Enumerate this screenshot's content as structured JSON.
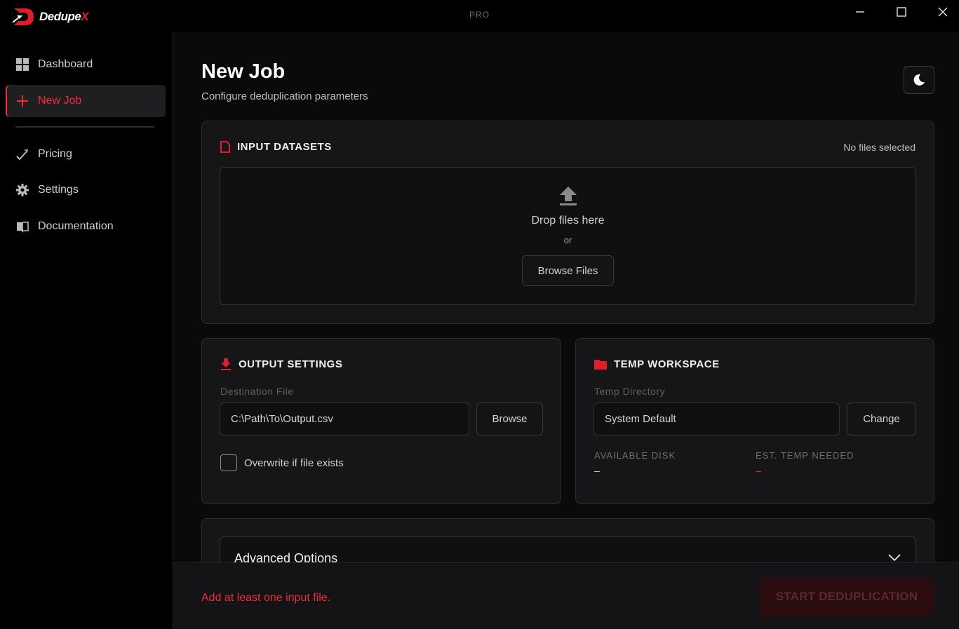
{
  "app": {
    "name_main": "Dedupe",
    "name_accent": "X",
    "edition": "PRO"
  },
  "colors": {
    "accent": "#ef2b36",
    "background": "#0a0a0a",
    "card": "#161618",
    "sidebar": "#000000"
  },
  "sidebar": {
    "items": [
      {
        "label": "Dashboard",
        "icon": "grid-icon",
        "active": false
      },
      {
        "label": "New Job",
        "icon": "plus-icon",
        "active": true
      },
      {
        "label": "Pricing",
        "icon": "trend-check-icon",
        "active": false
      },
      {
        "label": "Settings",
        "icon": "gear-icon",
        "active": false
      },
      {
        "label": "Documentation",
        "icon": "book-icon",
        "active": false
      }
    ]
  },
  "header": {
    "title": "New Job",
    "subtitle": "Configure deduplication parameters",
    "theme_toggle_icon": "moon-icon"
  },
  "input_datasets": {
    "title": "INPUT DATASETS",
    "status": "No files selected",
    "drop_text": "Drop files here",
    "or_text": "or",
    "browse_label": "Browse Files"
  },
  "output_settings": {
    "title": "OUTPUT SETTINGS",
    "field_label": "Destination File",
    "value": "C:\\Path\\To\\Output.csv",
    "browse_label": "Browse",
    "overwrite_label": "Overwrite if file exists",
    "overwrite_checked": false
  },
  "temp_workspace": {
    "title": "TEMP WORKSPACE",
    "field_label": "Temp Directory",
    "value": "System Default",
    "change_label": "Change",
    "available_disk_label": "AVAILABLE DISK",
    "available_disk_value": "–",
    "est_temp_label": "EST. TEMP NEEDED",
    "est_temp_value": "–"
  },
  "advanced": {
    "label": "Advanced Options"
  },
  "footer": {
    "error": "Add at least one input file.",
    "start_label": "START DEDUPLICATION"
  }
}
